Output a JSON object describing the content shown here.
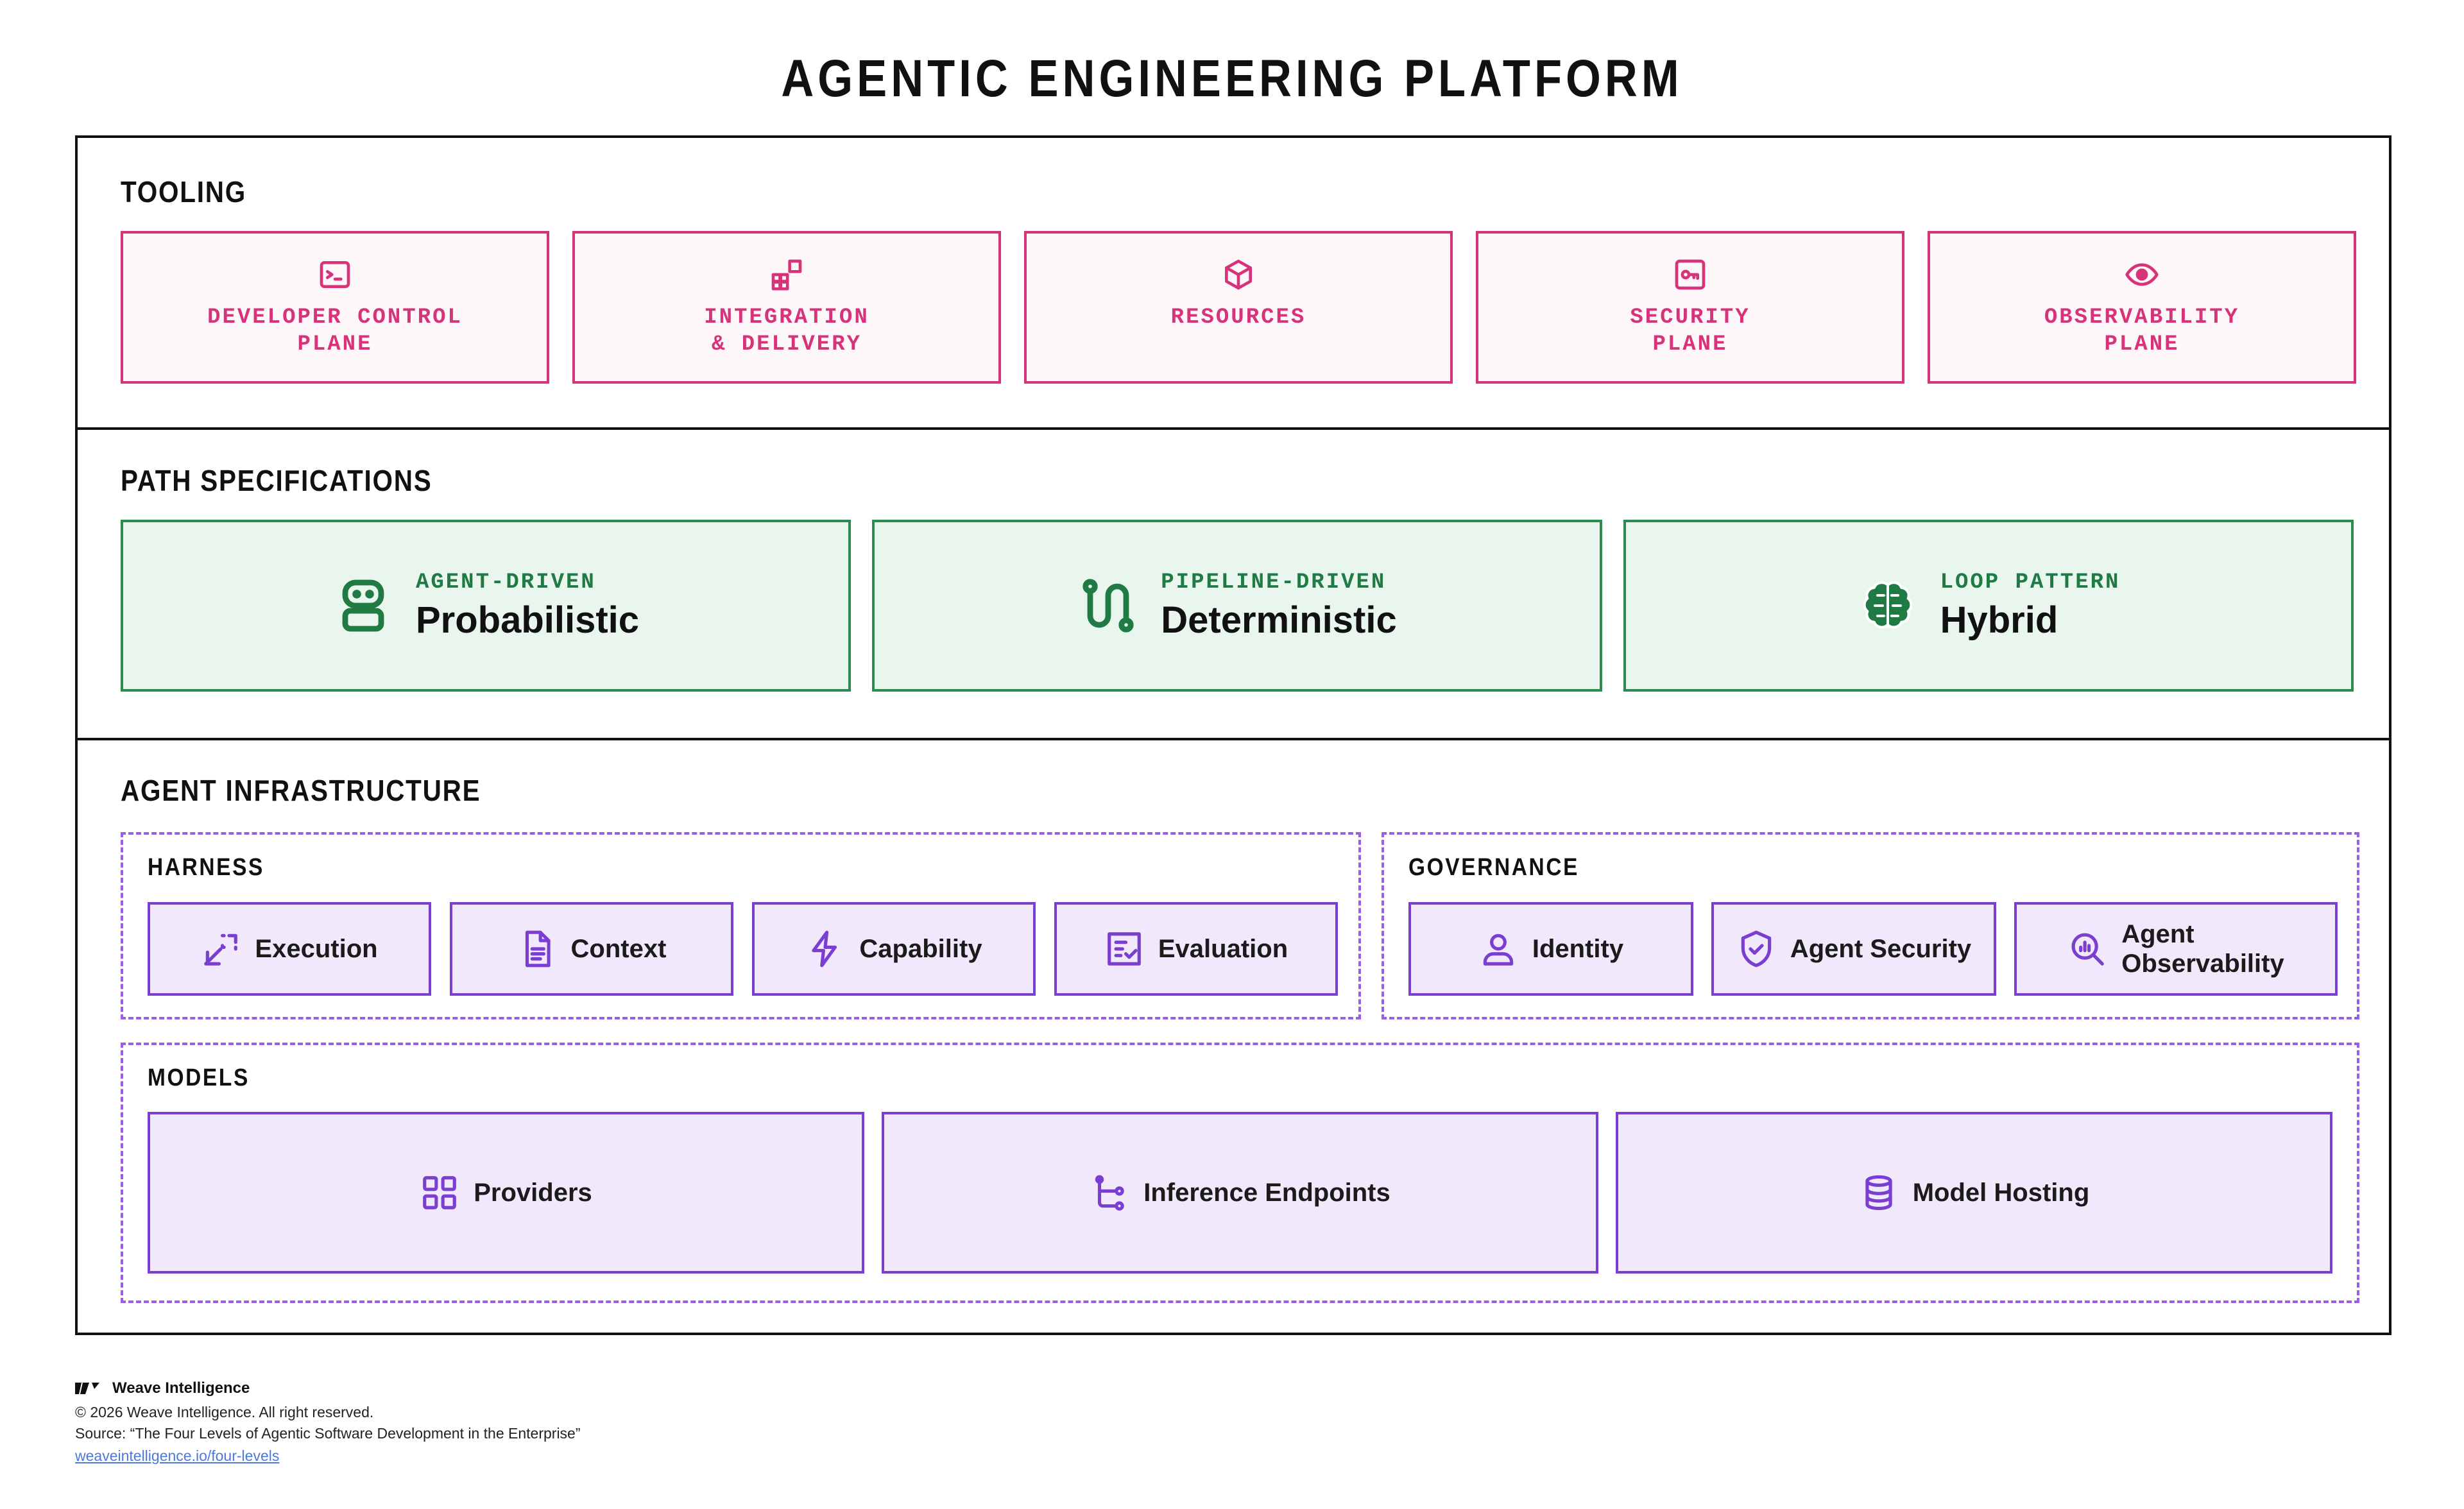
{
  "title": "AGENTIC ENGINEERING PLATFORM",
  "tooling": {
    "label": "TOOLING",
    "cards": [
      {
        "label": "DEVELOPER CONTROL\nPLANE",
        "icon": "terminal-icon"
      },
      {
        "label": "INTEGRATION\n& DELIVERY",
        "icon": "blocks-icon"
      },
      {
        "label": "RESOURCES",
        "icon": "cube-icon"
      },
      {
        "label": "SECURITY\nPLANE",
        "icon": "key-icon"
      },
      {
        "label": "OBSERVABILITY\nPLANE",
        "icon": "eye-icon"
      }
    ]
  },
  "paths": {
    "label": "PATH SPECIFICATIONS",
    "cards": [
      {
        "kicker": "AGENT-DRIVEN",
        "title": "Probabilistic",
        "icon": "bot-icon"
      },
      {
        "kicker": "PIPELINE-DRIVEN",
        "title": "Deterministic",
        "icon": "route-icon"
      },
      {
        "kicker": "LOOP PATTERN",
        "title": "Hybrid",
        "icon": "brain-icon"
      }
    ]
  },
  "infrastructure": {
    "label": "AGENT INFRASTRUCTURE",
    "harness": {
      "label": "HARNESS",
      "items": [
        {
          "label": "Execution",
          "icon": "arrow-target-icon"
        },
        {
          "label": "Context",
          "icon": "document-icon"
        },
        {
          "label": "Capability",
          "icon": "lightning-icon"
        },
        {
          "label": "Evaluation",
          "icon": "checklist-icon"
        }
      ]
    },
    "governance": {
      "label": "GOVERNANCE",
      "items": [
        {
          "label": "Identity",
          "icon": "user-icon"
        },
        {
          "label": "Agent Security",
          "icon": "shield-icon"
        },
        {
          "label": "Agent\nObservability",
          "icon": "search-chart-icon"
        }
      ]
    },
    "models": {
      "label": "MODELS",
      "items": [
        {
          "label": "Providers",
          "icon": "grid-icon"
        },
        {
          "label": "Inference Endpoints",
          "icon": "branch-icon"
        },
        {
          "label": "Model Hosting",
          "icon": "database-icon"
        }
      ]
    }
  },
  "footer": {
    "brand": "Weave Intelligence",
    "copyright": "© 2026 Weave Intelligence. All right reserved.",
    "source": "Source: “The Four Levels of Agentic Software Development in the Enterprise”",
    "link": "weaveintelligence.io/four-levels"
  },
  "colors": {
    "tooling": "#d6337a",
    "paths": "#2e8b4f",
    "infrastructure": "#7a3fd1"
  }
}
